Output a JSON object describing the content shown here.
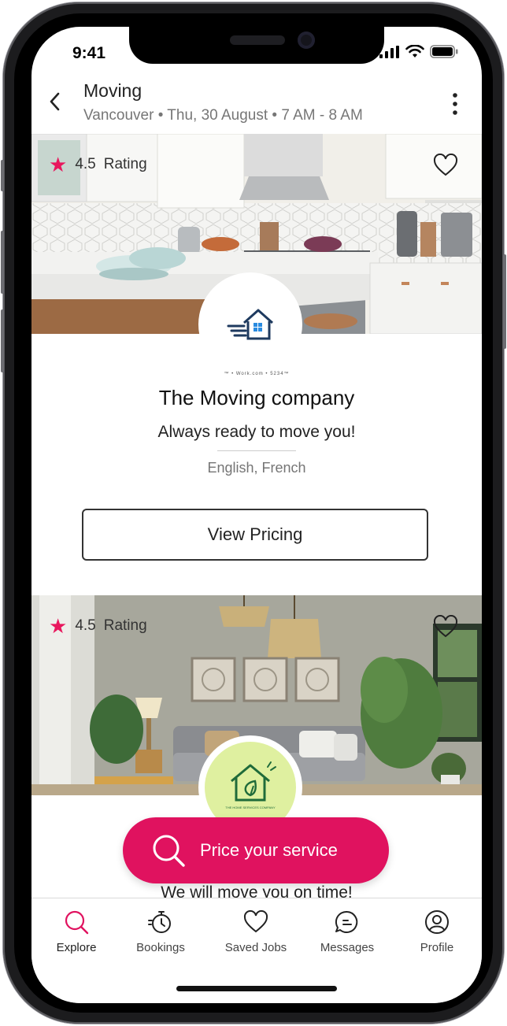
{
  "status": {
    "time": "9:41"
  },
  "header": {
    "title": "Moving",
    "subtitle": "Vancouver • Thu, 30 August • 7 AM - 8 AM"
  },
  "cards": [
    {
      "rating": "4.5",
      "rating_label": "Rating",
      "logo_fineprint": "™ • Work.com • 5234™",
      "name": "The Moving company",
      "tagline": "Always ready to move you!",
      "languages": "English, French",
      "button_label": "View Pricing"
    },
    {
      "rating": "4.5",
      "rating_label": "Rating",
      "logo_text": "THE HOME SERVICES COMPANY",
      "tagline": "We will move you on time!"
    }
  ],
  "cta": {
    "label": "Price your service"
  },
  "tabs": [
    {
      "label": "Explore",
      "icon": "search-icon"
    },
    {
      "label": "Bookings",
      "icon": "stopwatch-icon"
    },
    {
      "label": "Saved Jobs",
      "icon": "heart-icon"
    },
    {
      "label": "Messages",
      "icon": "chat-bubble-icon"
    },
    {
      "label": "Profile",
      "icon": "user-icon"
    }
  ],
  "colors": {
    "accent": "#e0125f",
    "star": "#e8175d",
    "logo_blue": "#1e3a5f",
    "logo_green_bg": "#dff0a0",
    "logo_green": "#1f6b3a"
  }
}
